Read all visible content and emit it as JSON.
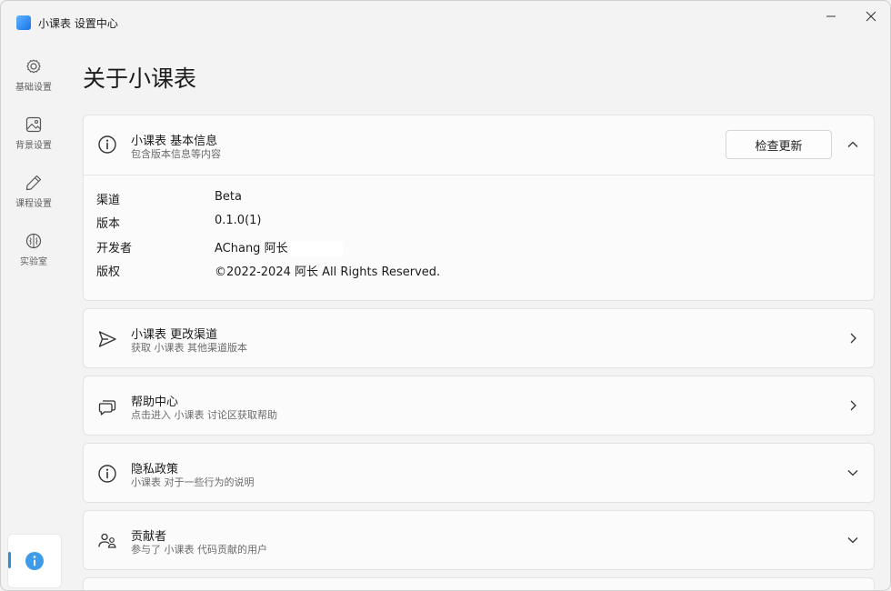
{
  "window": {
    "title": "小课表 设置中心"
  },
  "nav": {
    "items": [
      {
        "label": "基础设置",
        "icon": "gear-icon"
      },
      {
        "label": "背景设置",
        "icon": "image-icon"
      },
      {
        "label": "课程设置",
        "icon": "pen-icon"
      },
      {
        "label": "实验室",
        "icon": "brain-icon"
      }
    ],
    "active": {
      "icon": "info-icon"
    }
  },
  "page": {
    "title": "关于小课表"
  },
  "info_card": {
    "title": "小课表 基本信息",
    "subtitle": "包含版本信息等内容",
    "button": "检查更新",
    "rows": [
      {
        "key": "渠道",
        "value": "Beta"
      },
      {
        "key": "版本",
        "value": "0.1.0(1)"
      },
      {
        "key": "开发者",
        "value": "AChang 阿长"
      },
      {
        "key": "版权",
        "value": "©2022-2024 阿长 All Rights Reserved."
      }
    ]
  },
  "cards": [
    {
      "title": "小课表 更改渠道",
      "subtitle": "获取 小课表 其他渠道版本",
      "icon": "send-icon",
      "chevron": "chevron-right-icon"
    },
    {
      "title": "帮助中心",
      "subtitle": "点击进入 小课表 讨论区获取帮助",
      "icon": "chat-icon",
      "chevron": "chevron-right-icon"
    },
    {
      "title": "隐私政策",
      "subtitle": "小课表 对于一些行为的说明",
      "icon": "info-icon",
      "chevron": "chevron-down-icon"
    },
    {
      "title": "贡献者",
      "subtitle": "参与了 小课表 代码贡献的用户",
      "icon": "people-icon",
      "chevron": "chevron-down-icon"
    }
  ],
  "colors": {
    "accent": "#2a8fd7",
    "background": "#f3f3f3",
    "card": "#fbfbfb"
  }
}
